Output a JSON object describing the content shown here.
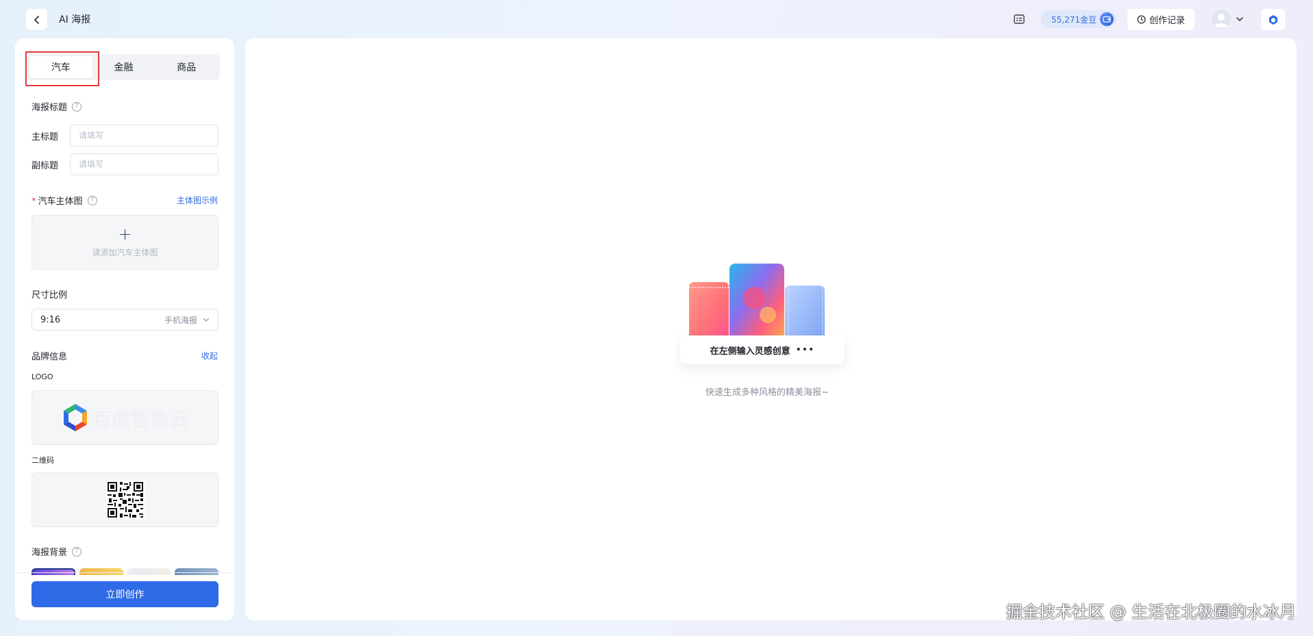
{
  "app": {
    "title": "AI 海报"
  },
  "topbar": {
    "coins_label": "55,271金豆",
    "records_label": "创作记录"
  },
  "left_panel": {
    "tabs": [
      {
        "label": "汽车",
        "active": true
      },
      {
        "label": "金融",
        "active": false
      },
      {
        "label": "商品",
        "active": false
      }
    ],
    "poster_title_section": "海报标题",
    "main_title_label": "主标题",
    "main_title_placeholder": "请填写",
    "sub_title_label": "副标题",
    "sub_title_placeholder": "请填写",
    "car_image_label": "汽车主体图",
    "car_image_example_link": "主体图示例",
    "car_image_upload_hint": "请添加汽车主体图",
    "ratio_label": "尺寸比例",
    "ratio_value": "9:16",
    "ratio_sub": "手机海报",
    "brand_info_label": "品牌信息",
    "brand_collapse_link": "收起",
    "logo_label": "LOGO",
    "logo_text": "百度智能云",
    "qrcode_label": "二维码",
    "background_label": "海报背景",
    "create_button": "立即创作"
  },
  "main": {
    "empty_prompt": "在左侧输入灵感创意",
    "empty_caption": "快速生成多种风格的精美海报~"
  },
  "watermark": "掘金技术社区 @ 生活在北极圈的水冰月",
  "colors": {
    "primary": "#2f6be6",
    "highlight_box": "#e23c3c"
  }
}
